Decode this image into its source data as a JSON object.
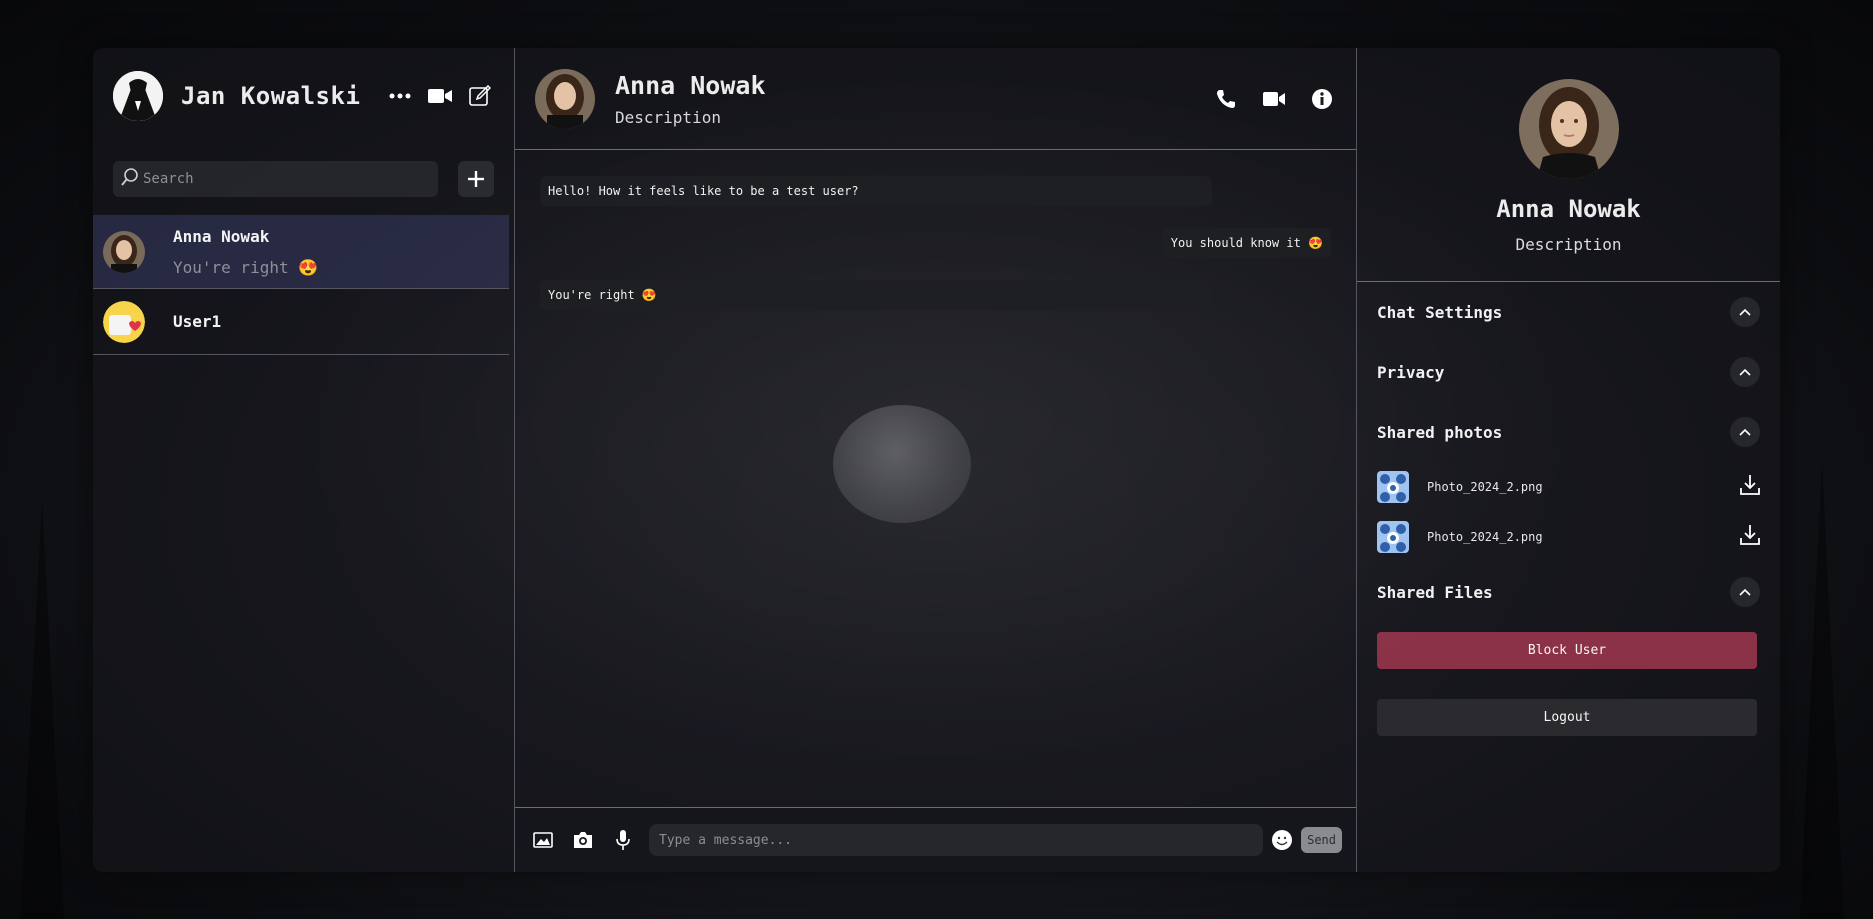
{
  "me": {
    "name": "Jan Kowalski"
  },
  "search": {
    "placeholder": "Search"
  },
  "chats": [
    {
      "name": "Anna Nowak",
      "last": "You're right 😍"
    },
    {
      "name": "User1",
      "last": ""
    }
  ],
  "active_chat": {
    "name": "Anna Nowak",
    "description": "Description"
  },
  "messages": [
    {
      "direction": "in",
      "text": "Hello! How it feels like to be a test user?"
    },
    {
      "direction": "out",
      "text": "You should know it 😍"
    },
    {
      "direction": "in",
      "text": "You're right 😍"
    }
  ],
  "composer": {
    "placeholder": "Type a message...",
    "send_label": "Send"
  },
  "profile": {
    "name": "Anna Nowak",
    "description": "Description"
  },
  "sections": {
    "chat_settings": "Chat Settings",
    "privacy": "Privacy",
    "shared_photos": "Shared photos",
    "shared_files": "Shared Files"
  },
  "shared_photos": [
    {
      "name": "Photo_2024_2.png"
    },
    {
      "name": "Photo_2024_2.png"
    }
  ],
  "actions": {
    "block": "Block User",
    "logout": "Logout"
  },
  "colors": {
    "block": "#8b3248",
    "active_chat": "#3c3f6e",
    "panel": "#16171d"
  }
}
